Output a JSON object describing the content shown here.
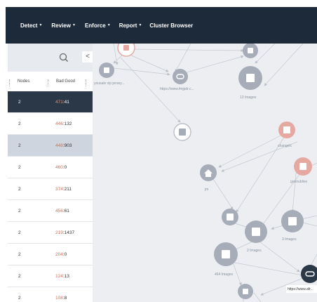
{
  "topnav": {
    "items": [
      {
        "label": "Detect",
        "has_menu": true
      },
      {
        "label": "Review",
        "has_menu": true
      },
      {
        "label": "Enforce",
        "has_menu": true
      },
      {
        "label": "Report",
        "has_menu": true
      },
      {
        "label": "Cluster Browser",
        "has_menu": false
      }
    ]
  },
  "panel": {
    "collapse_label": "<",
    "columns": [
      "Nodes",
      "Bad:Good"
    ],
    "rows": [
      {
        "nodes": "2",
        "bad": "471",
        "good": ":41",
        "state": "selected"
      },
      {
        "nodes": "2",
        "bad": "446",
        "good": ":132",
        "state": ""
      },
      {
        "nodes": "2",
        "bad": "448",
        "good": ":903",
        "state": "highlight"
      },
      {
        "nodes": "2",
        "bad": "460",
        "good": ":0",
        "state": ""
      },
      {
        "nodes": "2",
        "bad": "374",
        "good": ":211",
        "state": ""
      },
      {
        "nodes": "2",
        "bad": "456",
        "good": ":61",
        "state": ""
      },
      {
        "nodes": "2",
        "bad": "219",
        "good": ":1437",
        "state": ""
      },
      {
        "nodes": "2",
        "bad": "204",
        "good": ":0",
        "state": ""
      },
      {
        "nodes": "2",
        "bad": "124",
        "good": ":13",
        "state": ""
      },
      {
        "nodes": "2",
        "bad": "108",
        "good": ":8",
        "state": ""
      }
    ]
  },
  "graph": {
    "labels": {
      "n_url1": "https://www.fmjpdr.c...",
      "n_13images": "13 Images",
      "n_user": "yousale vip jersey...",
      "n_changelc": "changelc",
      "n_gonirublive": "gonirublive",
      "n_jm": "jm",
      "n_3images": "3 Images",
      "n_2images": "2 Images",
      "n_464images": "464 Images",
      "n_tooltip": "https://www.afr..."
    }
  },
  "colors": {
    "topbar": "#1d2a3a",
    "bad_count": "#e06a4f",
    "selected_row": "#2b3848",
    "node_gray": "#a6adb8",
    "node_red": "#e6a9a1"
  }
}
